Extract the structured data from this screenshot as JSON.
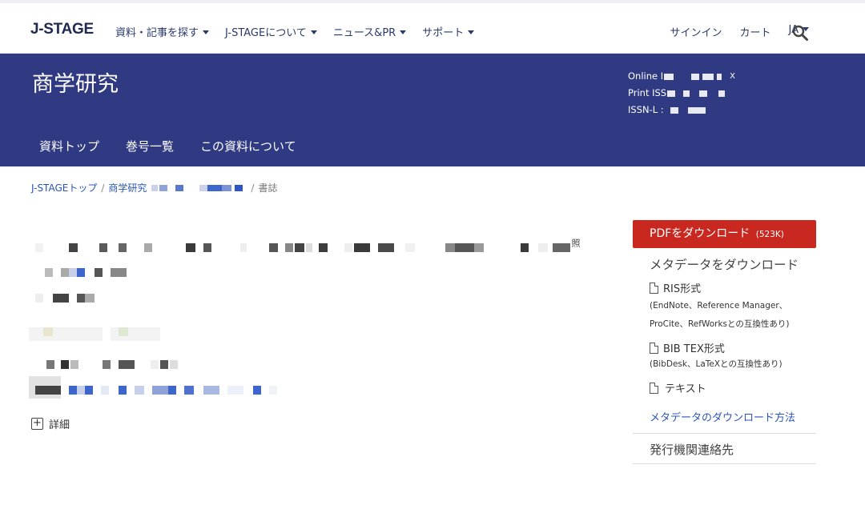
{
  "header": {
    "logo": "J-STAGE",
    "nav_left": [
      "資料・記事を探す",
      "J-STAGEについて",
      "ニュース&PR",
      "サポート"
    ],
    "nav_right": {
      "signin": "サインイン",
      "cart": "カート",
      "lang": "JA"
    },
    "search_icon": "search-icon"
  },
  "banner": {
    "journal_title": "商学研究",
    "issn": {
      "online_label": "Online I",
      "online_tail": "X",
      "print_label": "Print ISS",
      "l_label": "ISSN-L :"
    },
    "subnav": [
      "資料トップ",
      "巻号一覧",
      "この資料について"
    ]
  },
  "breadcrumb": {
    "home": "J-STAGEトップ",
    "journal": "商学研究",
    "current": "書誌"
  },
  "article": {
    "details_label": "詳細",
    "trailing_char": "照"
  },
  "sidebar": {
    "pdf_button": "PDFをダウンロード",
    "pdf_size": "(523K)",
    "metadata_heading": "メタデータをダウンロード",
    "ris_label": "RIS形式",
    "ris_compat_1": "(EndNote、Reference Manager、",
    "ris_compat_2": "ProCite、RefWorksとの互換性あり)",
    "bib_label": "BIB TEX形式",
    "bib_compat": "(BibDesk、LaTeXとの互換性あり)",
    "text_label": "テキスト",
    "howto_link": "メタデータのダウンロード方法",
    "contact": "発行機関連絡先"
  },
  "colors": {
    "banner": "#2f3a82",
    "pdf_button": "#c8281f",
    "link": "#2a55b8"
  }
}
